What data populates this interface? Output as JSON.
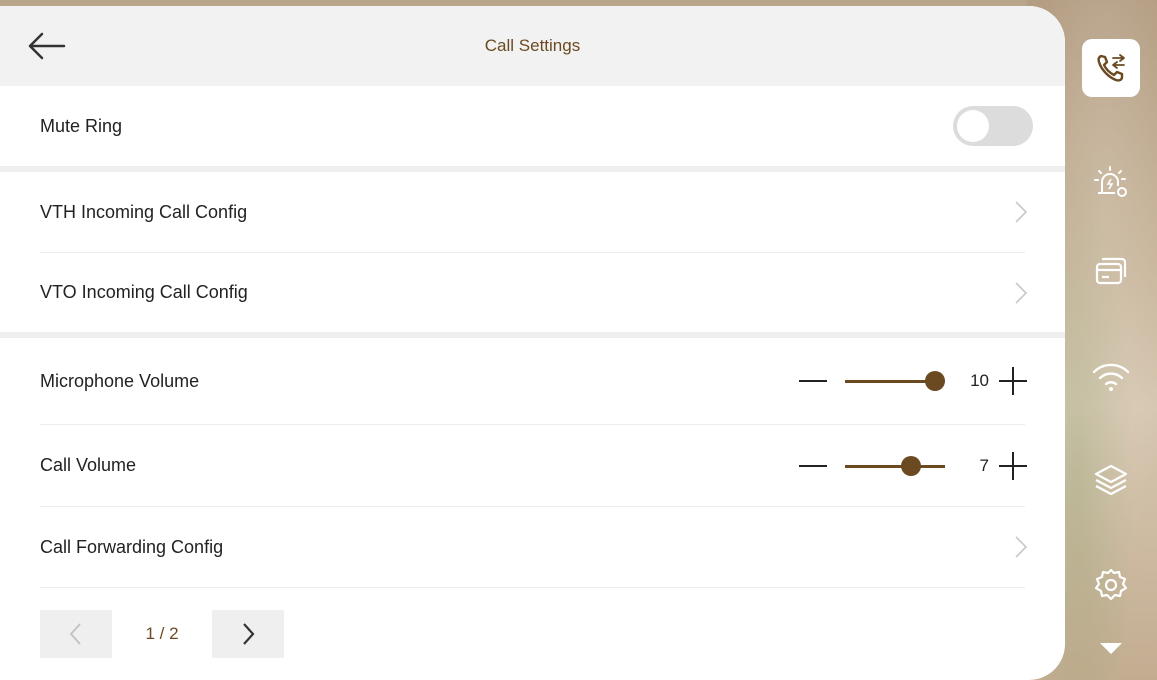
{
  "header": {
    "title": "Call Settings"
  },
  "rows": {
    "mute_ring": {
      "label": "Mute Ring",
      "enabled": false
    },
    "vth": {
      "label": "VTH Incoming Call Config"
    },
    "vto": {
      "label": "VTO Incoming Call Config"
    },
    "mic_volume": {
      "label": "Microphone Volume",
      "value": "10",
      "max": 10
    },
    "call_volume": {
      "label": "Call Volume",
      "value": "7",
      "max": 10
    },
    "forwarding": {
      "label": "Call Forwarding Config"
    }
  },
  "pager": {
    "text": "1 / 2"
  },
  "sidebar": {
    "items": [
      {
        "icon": "call-settings-icon",
        "active": true
      },
      {
        "icon": "alarm-settings-icon",
        "active": false
      },
      {
        "icon": "card-icon",
        "active": false
      },
      {
        "icon": "wifi-icon",
        "active": false
      },
      {
        "icon": "layers-icon",
        "active": false
      },
      {
        "icon": "gear-icon",
        "active": false
      },
      {
        "icon": "more-down-icon",
        "active": false
      }
    ]
  },
  "colors": {
    "accent": "#6b4a22",
    "panel": "#ffffff",
    "header_bg": "#f2f2f2"
  }
}
